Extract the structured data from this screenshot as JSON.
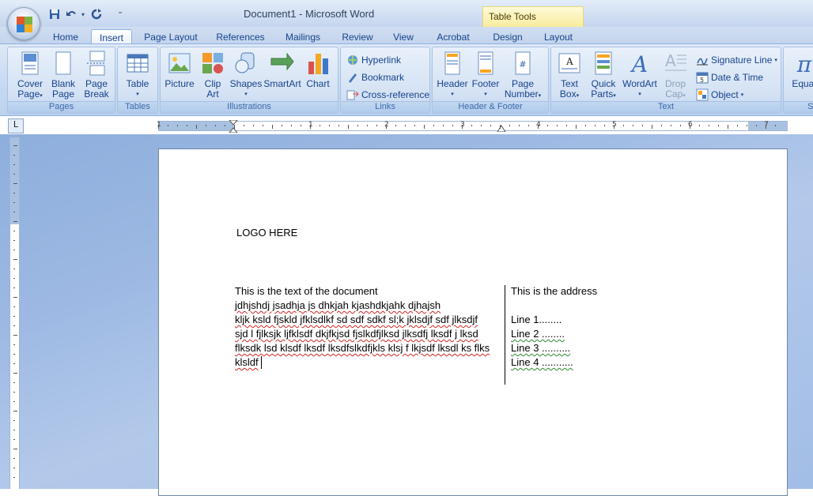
{
  "window": {
    "title": "Document1 - Microsoft Word",
    "contextual_tab": "Table Tools"
  },
  "tabs": [
    "Home",
    "Insert",
    "Page Layout",
    "References",
    "Mailings",
    "Review",
    "View",
    "Acrobat",
    "Design",
    "Layout"
  ],
  "active_tab": "Insert",
  "ribbon": {
    "pages": {
      "label": "Pages",
      "cover": "Cover",
      "cover2": "Page",
      "blank": "Blank",
      "blank2": "Page",
      "break": "Page",
      "break2": "Break"
    },
    "tables": {
      "label": "Tables",
      "table": "Table"
    },
    "illustrations": {
      "label": "Illustrations",
      "picture": "Picture",
      "clip": "Clip",
      "clip2": "Art",
      "shapes": "Shapes",
      "smartart": "SmartArt",
      "chart": "Chart"
    },
    "links": {
      "label": "Links",
      "hyperlink": "Hyperlink",
      "bookmark": "Bookmark",
      "crossref": "Cross-reference"
    },
    "header_footer": {
      "label": "Header & Footer",
      "header": "Header",
      "footer": "Footer",
      "page": "Page",
      "number": "Number"
    },
    "text": {
      "label": "Text",
      "textbox": "Text",
      "textbox2": "Box",
      "quick": "Quick",
      "quick2": "Parts",
      "wordart": "WordArt",
      "drop": "Drop",
      "drop2": "Cap",
      "sigline": "Signature Line",
      "datetime": "Date & Time",
      "object": "Object"
    },
    "symbols": {
      "equation": "Equat",
      "label_partial": "S"
    }
  },
  "ruler": {
    "numbers": [
      "1",
      "1",
      "2",
      "3",
      "4",
      "5",
      "6",
      "7"
    ],
    "corner": "L"
  },
  "document": {
    "logo": "LOGO HERE",
    "left_col": [
      "This is  the text of the document",
      " jdhjshdj jsadhja js dhkjah  kjashdkjahk djhajsh",
      "kljk ksld fjskld jfklsdlkf sd sdf sdkf sl;k jklsdjf sdf jlksdjf",
      "sjd l fjlksjk ljfklsdf dkjfkjsd fjslkdfjlksd jlksdfj lksdf j lksd",
      "flksdk lsd klsdf lksdf lksdfslkdfjkls klsj f lkjsdf lksdl ks flks",
      "klsldf"
    ],
    "right_col": {
      "heading": "This is  the address",
      "lines": [
        "Line 1........",
        "Line 2 ........",
        "Line 3 ..........",
        "Line 4 ..........."
      ]
    }
  }
}
